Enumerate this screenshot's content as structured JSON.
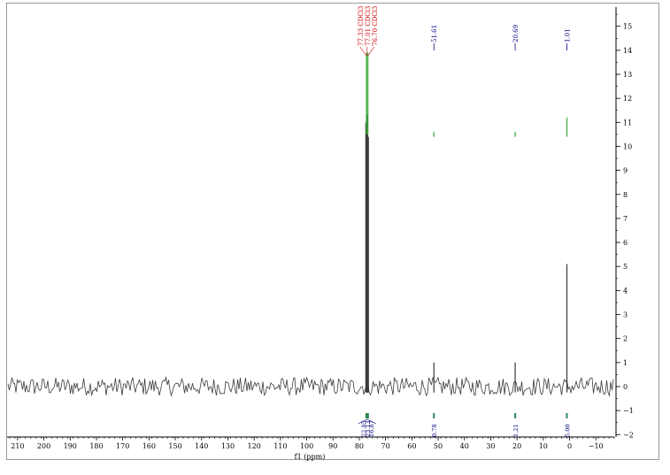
{
  "chart_data": {
    "type": "line",
    "title": "",
    "xlabel": "f1 (ppm)",
    "ylabel": "",
    "x_reversed": true,
    "xlim": [
      214,
      -17
    ],
    "ylim": [
      -2.1,
      15.8
    ],
    "x_ticks": [
      210,
      200,
      190,
      180,
      170,
      160,
      150,
      140,
      130,
      120,
      110,
      100,
      90,
      80,
      70,
      60,
      50,
      40,
      30,
      20,
      10,
      0,
      -10
    ],
    "x_tick_labels": [
      "210",
      "200",
      "190",
      "180",
      "170",
      "160",
      "150",
      "140",
      "130",
      "120",
      "110",
      "100",
      "90",
      "80",
      "70",
      "60",
      "50",
      "40",
      "30",
      "20",
      "10",
      "0",
      "−10"
    ],
    "y_ticks": [
      15,
      14,
      13,
      12,
      11,
      10,
      9,
      8,
      7,
      6,
      5,
      4,
      3,
      2,
      1,
      0,
      -1,
      -2
    ],
    "y_tick_labels": [
      "15",
      "14",
      "13",
      "12",
      "11",
      "10",
      "9",
      "8",
      "7",
      "6",
      "5",
      "4",
      "3",
      "2",
      "1",
      "0",
      "−1",
      "−2"
    ],
    "grid": false,
    "noise_baseline": 0,
    "peaks": [
      {
        "ppm": 77.33,
        "height": 11.0
      },
      {
        "ppm": 77.01,
        "height": 11.3
      },
      {
        "ppm": 76.7,
        "height": 10.4
      },
      {
        "ppm": 51.61,
        "height": 1.0
      },
      {
        "ppm": 20.69,
        "height": 1.0
      },
      {
        "ppm": 1.01,
        "height": 5.1
      }
    ],
    "integral_curves": [
      {
        "ppm": 77.0,
        "bottom": 10.5,
        "top": 13.9
      },
      {
        "ppm": 51.61,
        "bottom": 10.4,
        "top": 10.6
      },
      {
        "ppm": 20.69,
        "bottom": 10.4,
        "top": 10.6
      },
      {
        "ppm": 1.01,
        "bottom": 10.4,
        "top": 11.2
      }
    ],
    "peak_labels": [
      {
        "text": "77.33 CDCl3",
        "ppm": 77.33,
        "color": "#cc0000"
      },
      {
        "text": "77.01 CDCl3",
        "ppm": 77.01,
        "color": "#cc0000"
      },
      {
        "text": "76.70 CDCl3",
        "ppm": 76.7,
        "color": "#cc0000"
      },
      {
        "text": "51.61",
        "ppm": 51.61,
        "color": "#000080"
      },
      {
        "text": "20.69",
        "ppm": 20.69,
        "color": "#000080"
      },
      {
        "text": "1.01",
        "ppm": 1.01,
        "color": "#000080"
      }
    ],
    "integrals": [
      {
        "text": "22.85",
        "ppm": 78.4,
        "color": "#000080"
      },
      {
        "text": "23.13",
        "ppm": 77.0,
        "color": "#000080"
      },
      {
        "text": "16.87",
        "ppm": 75.6,
        "color": "#000080"
      },
      {
        "text": "0.78",
        "ppm": 51.61,
        "color": "#000080"
      },
      {
        "text": "1.21",
        "ppm": 20.69,
        "color": "#000080"
      },
      {
        "text": "5.00",
        "ppm": 1.01,
        "color": "#000080"
      }
    ],
    "colors": {
      "spectrum": "#3a3a3a",
      "peak_label_solvent": "#cc0000",
      "peak_label": "#000080",
      "integral_curve": "#3aa83a",
      "integral_marker": "#2e8b57",
      "axis": "#000000"
    }
  }
}
